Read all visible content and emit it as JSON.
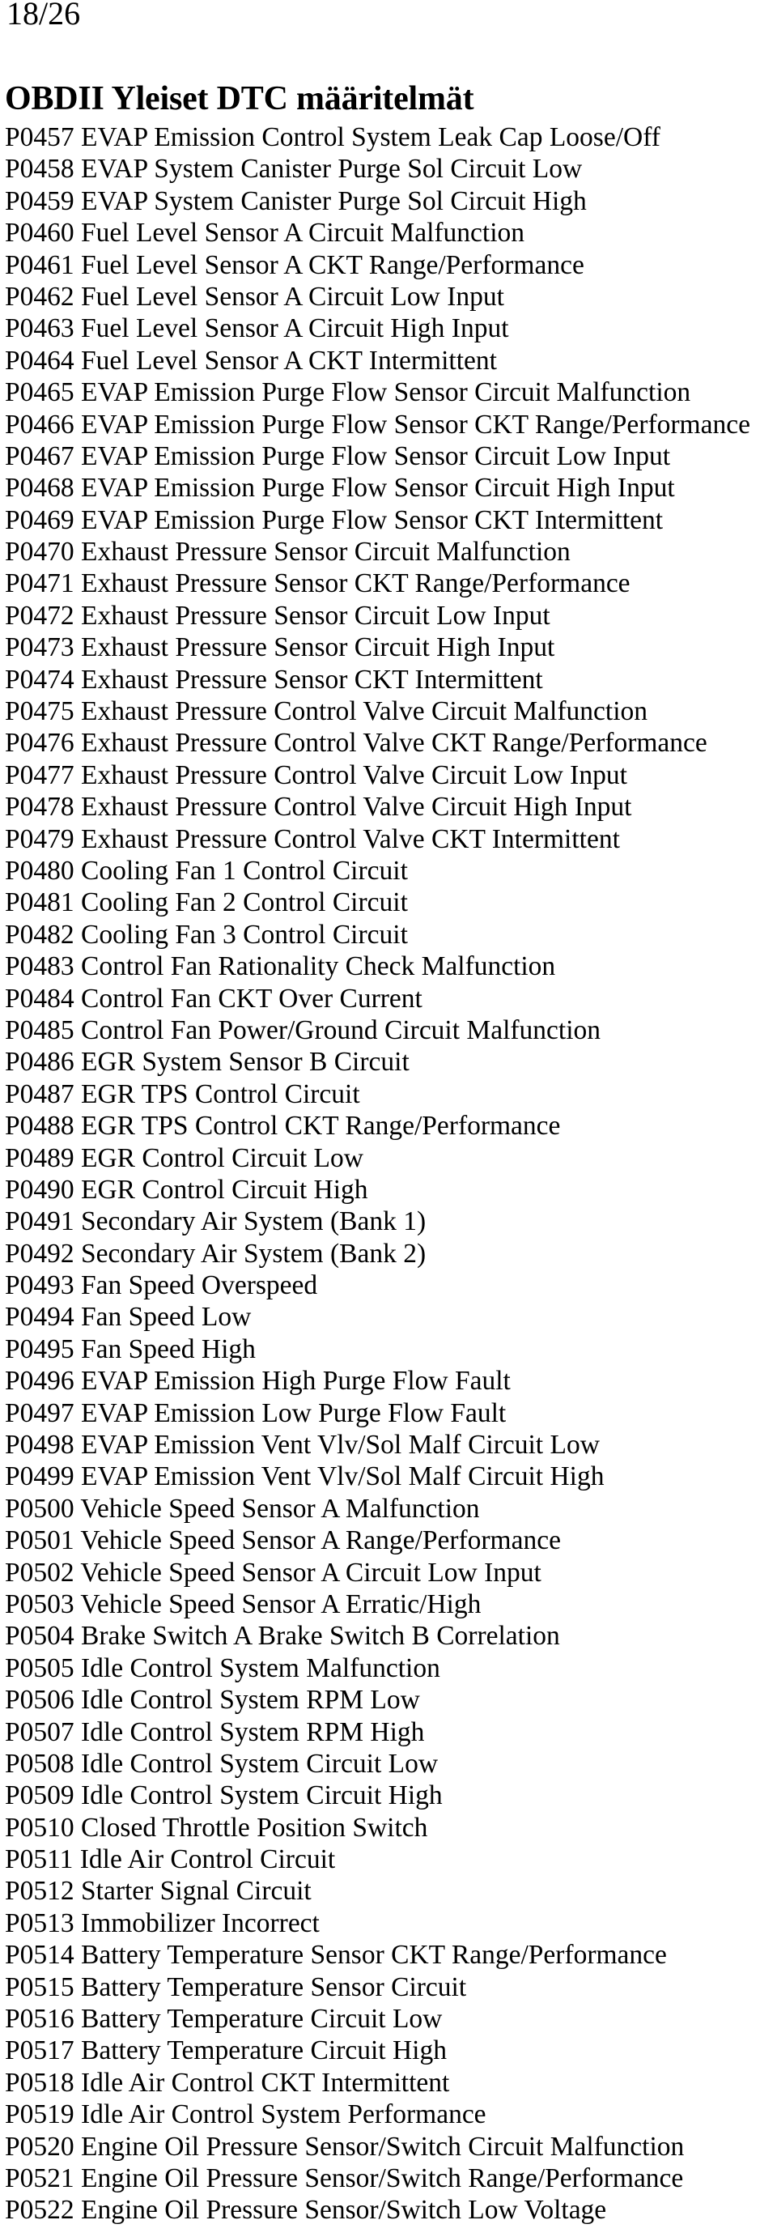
{
  "page": {
    "page_number": "18/26",
    "title": "OBDII Yleiset DTC määritelmät"
  },
  "dtc_codes": [
    {
      "code": "P0457",
      "description": "EVAP Emission Control System Leak Cap Loose/Off"
    },
    {
      "code": "P0458",
      "description": "EVAP System Canister Purge Sol Circuit Low"
    },
    {
      "code": "P0459",
      "description": "EVAP System Canister Purge Sol Circuit High"
    },
    {
      "code": "P0460",
      "description": "Fuel Level Sensor A Circuit Malfunction"
    },
    {
      "code": "P0461",
      "description": "Fuel Level Sensor A CKT Range/Performance"
    },
    {
      "code": "P0462",
      "description": "Fuel Level Sensor A Circuit Low Input"
    },
    {
      "code": "P0463",
      "description": "Fuel Level Sensor A Circuit High Input"
    },
    {
      "code": "P0464",
      "description": "Fuel Level Sensor A CKT Intermittent"
    },
    {
      "code": "P0465",
      "description": "EVAP Emission Purge Flow Sensor Circuit Malfunction"
    },
    {
      "code": "P0466",
      "description": "EVAP Emission Purge Flow Sensor CKT Range/Performance"
    },
    {
      "code": "P0467",
      "description": "EVAP Emission Purge Flow Sensor Circuit Low Input"
    },
    {
      "code": "P0468",
      "description": "EVAP Emission Purge Flow Sensor Circuit High Input"
    },
    {
      "code": "P0469",
      "description": "EVAP Emission Purge Flow Sensor CKT Intermittent"
    },
    {
      "code": "P0470",
      "description": "Exhaust Pressure Sensor Circuit Malfunction"
    },
    {
      "code": "P0471",
      "description": "Exhaust Pressure Sensor CKT Range/Performance"
    },
    {
      "code": "P0472",
      "description": "Exhaust Pressure Sensor Circuit Low Input"
    },
    {
      "code": "P0473",
      "description": "Exhaust Pressure Sensor Circuit High Input"
    },
    {
      "code": "P0474",
      "description": "Exhaust Pressure Sensor CKT Intermittent"
    },
    {
      "code": "P0475",
      "description": "Exhaust Pressure Control Valve Circuit Malfunction"
    },
    {
      "code": "P0476",
      "description": "Exhaust Pressure Control Valve CKT Range/Performance"
    },
    {
      "code": "P0477",
      "description": "Exhaust Pressure Control Valve Circuit Low Input"
    },
    {
      "code": "P0478",
      "description": "Exhaust Pressure Control Valve Circuit High Input"
    },
    {
      "code": "P0479",
      "description": "Exhaust Pressure Control Valve CKT Intermittent"
    },
    {
      "code": "P0480",
      "description": "Cooling Fan 1 Control Circuit"
    },
    {
      "code": "P0481",
      "description": "Cooling Fan 2 Control Circuit"
    },
    {
      "code": "P0482",
      "description": "Cooling Fan 3 Control Circuit"
    },
    {
      "code": "P0483",
      "description": "Control Fan Rationality Check Malfunction"
    },
    {
      "code": "P0484",
      "description": "Control Fan CKT Over Current"
    },
    {
      "code": "P0485",
      "description": "Control Fan Power/Ground Circuit Malfunction"
    },
    {
      "code": "P0486",
      "description": "EGR System Sensor B Circuit"
    },
    {
      "code": "P0487",
      "description": "EGR TPS Control Circuit"
    },
    {
      "code": "P0488",
      "description": "EGR TPS Control CKT Range/Performance"
    },
    {
      "code": "P0489",
      "description": "EGR Control Circuit Low"
    },
    {
      "code": "P0490",
      "description": "EGR Control Circuit High"
    },
    {
      "code": "P0491",
      "description": "Secondary Air System (Bank 1)"
    },
    {
      "code": "P0492",
      "description": "Secondary Air System (Bank 2)"
    },
    {
      "code": "P0493",
      "description": "Fan Speed Overspeed"
    },
    {
      "code": "P0494",
      "description": "Fan Speed Low"
    },
    {
      "code": "P0495",
      "description": "Fan Speed High"
    },
    {
      "code": "P0496",
      "description": "EVAP Emission High Purge Flow Fault"
    },
    {
      "code": "P0497",
      "description": "EVAP Emission Low Purge Flow Fault"
    },
    {
      "code": "P0498",
      "description": "EVAP Emission Vent Vlv/Sol Malf Circuit Low"
    },
    {
      "code": "P0499",
      "description": "EVAP Emission Vent Vlv/Sol Malf Circuit High"
    },
    {
      "code": "P0500",
      "description": "Vehicle Speed Sensor A Malfunction"
    },
    {
      "code": "P0501",
      "description": "Vehicle Speed Sensor A Range/Performance"
    },
    {
      "code": "P0502",
      "description": "Vehicle Speed Sensor A Circuit Low Input"
    },
    {
      "code": "P0503",
      "description": "Vehicle Speed Sensor A Erratic/High"
    },
    {
      "code": "P0504",
      "description": "Brake Switch A Brake Switch B Correlation"
    },
    {
      "code": "P0505",
      "description": "Idle Control System Malfunction"
    },
    {
      "code": "P0506",
      "description": "Idle Control System RPM Low"
    },
    {
      "code": "P0507",
      "description": "Idle Control System RPM High"
    },
    {
      "code": "P0508",
      "description": "Idle Control System Circuit Low"
    },
    {
      "code": "P0509",
      "description": "Idle Control System Circuit High"
    },
    {
      "code": "P0510",
      "description": "Closed Throttle Position Switch"
    },
    {
      "code": "P0511",
      "description": "Idle Air Control Circuit"
    },
    {
      "code": "P0512",
      "description": "Starter Signal Circuit"
    },
    {
      "code": "P0513",
      "description": "Immobilizer Incorrect"
    },
    {
      "code": "P0514",
      "description": "Battery Temperature Sensor CKT Range/Performance"
    },
    {
      "code": "P0515",
      "description": "Battery Temperature Sensor Circuit"
    },
    {
      "code": "P0516",
      "description": "Battery Temperature Circuit Low"
    },
    {
      "code": "P0517",
      "description": "Battery Temperature Circuit High"
    },
    {
      "code": "P0518",
      "description": "Idle Air Control CKT Intermittent"
    },
    {
      "code": "P0519",
      "description": "Idle Air Control System Performance"
    },
    {
      "code": "P0520",
      "description": "Engine Oil Pressure Sensor/Switch Circuit Malfunction"
    },
    {
      "code": "P0521",
      "description": "Engine Oil Pressure Sensor/Switch Range/Performance"
    },
    {
      "code": "P0522",
      "description": "Engine Oil Pressure Sensor/Switch Low Voltage"
    }
  ]
}
